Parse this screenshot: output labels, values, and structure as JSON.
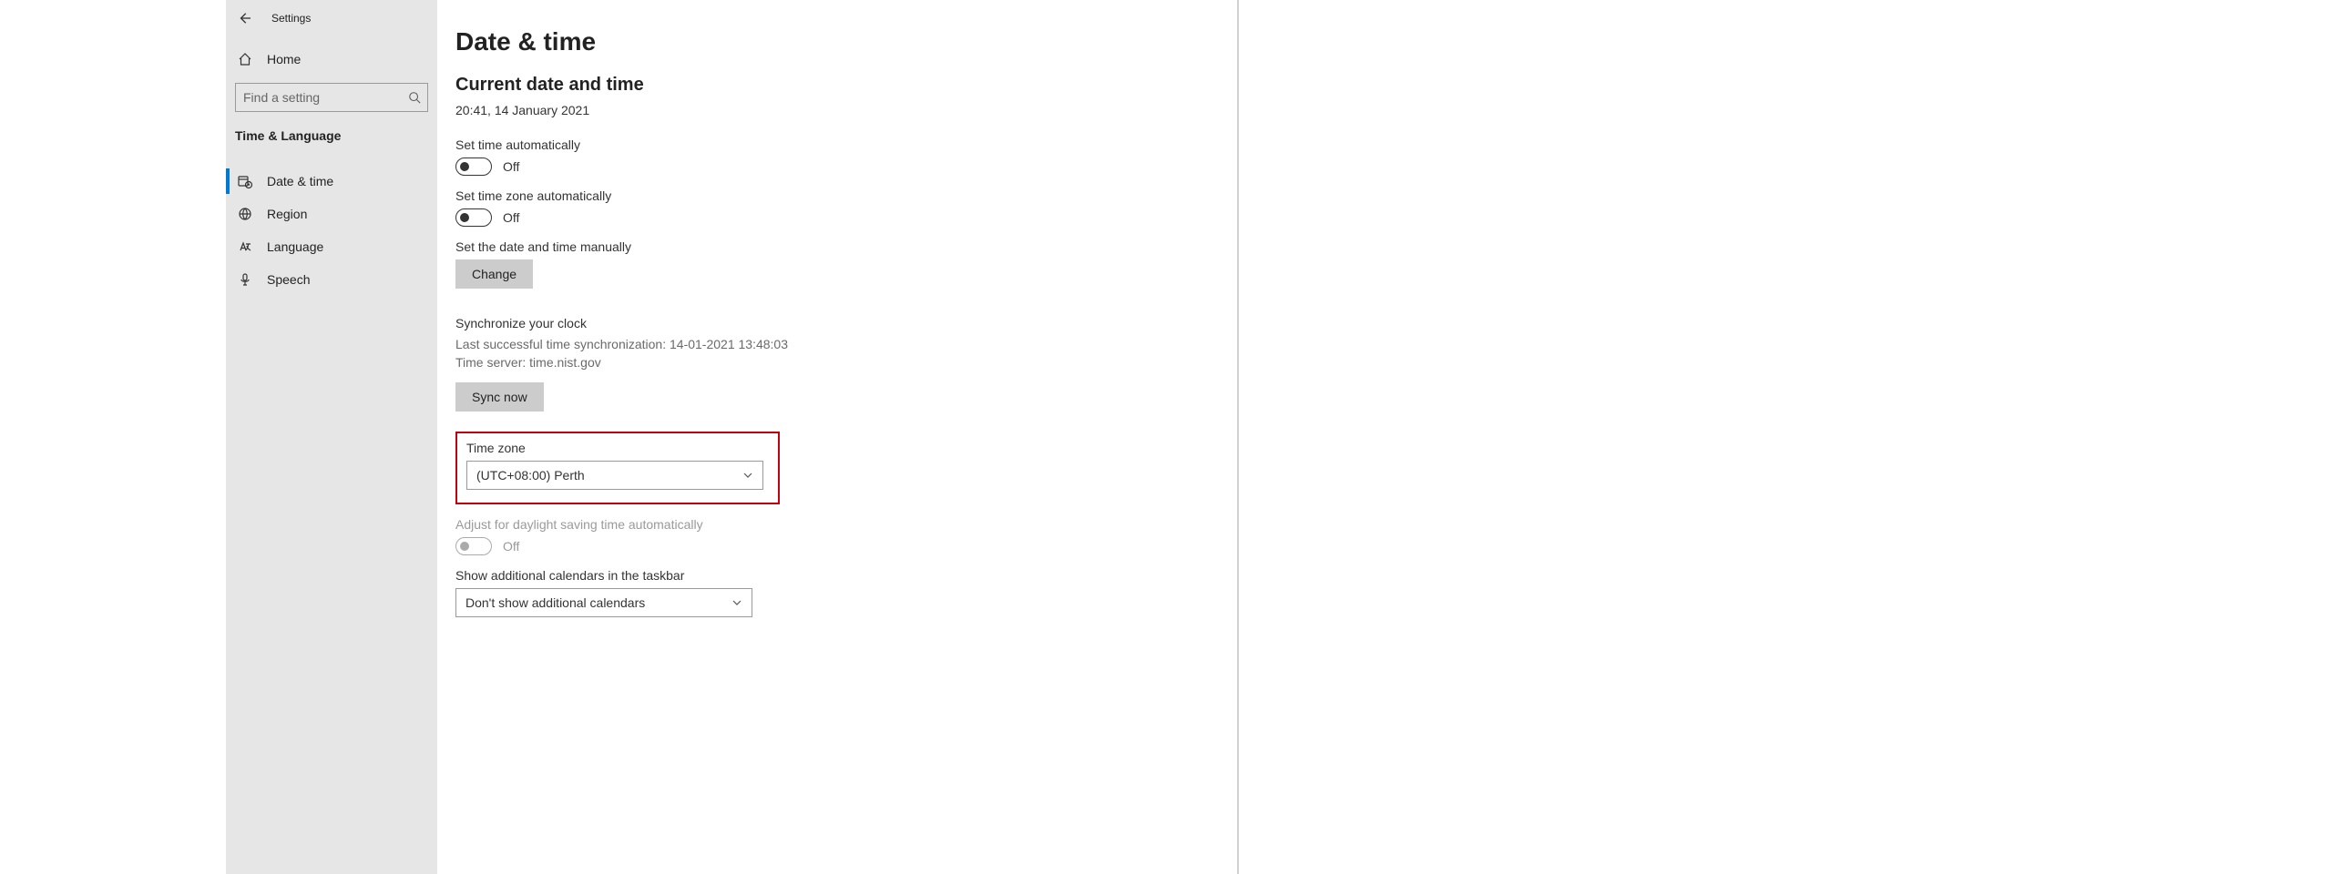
{
  "header": {
    "title": "Settings"
  },
  "sidebar": {
    "home": "Home",
    "search_placeholder": "Find a setting",
    "section": "Time & Language",
    "items": [
      {
        "label": "Date & time"
      },
      {
        "label": "Region"
      },
      {
        "label": "Language"
      },
      {
        "label": "Speech"
      }
    ]
  },
  "main": {
    "title": "Date & time",
    "subtitle": "Current date and time",
    "datetime": "20:41, 14 January 2021",
    "set_time_auto": {
      "label": "Set time automatically",
      "state": "Off"
    },
    "set_tz_auto": {
      "label": "Set time zone automatically",
      "state": "Off"
    },
    "manual": {
      "label": "Set the date and time manually",
      "button": "Change"
    },
    "sync": {
      "label": "Synchronize your clock",
      "last_line": "Last successful time synchronization: 14-01-2021 13:48:03",
      "server_line": "Time server: time.nist.gov",
      "button": "Sync now"
    },
    "tz": {
      "label": "Time zone",
      "value": "(UTC+08:00) Perth"
    },
    "dst": {
      "label": "Adjust for daylight saving time automatically",
      "state": "Off"
    },
    "calendars": {
      "label": "Show additional calendars in the taskbar",
      "value": "Don't show additional calendars"
    }
  }
}
